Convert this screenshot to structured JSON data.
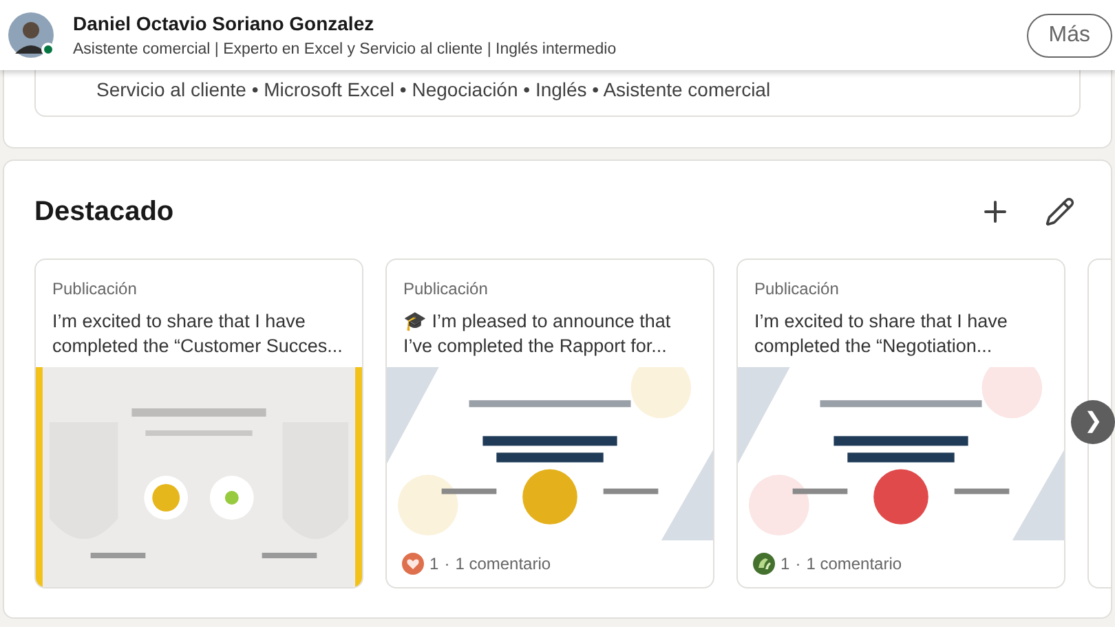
{
  "header": {
    "name": "Daniel Octavio Soriano Gonzalez",
    "headline": "Asistente comercial | Experto en Excel y Servicio al cliente | Inglés intermedio",
    "online": true,
    "more_button": "Más"
  },
  "skills": {
    "text": "Servicio al cliente • Microsoft Excel • Negociación • Inglés • Asistente comercial"
  },
  "featured": {
    "title": "Destacado",
    "items": [
      {
        "label": "Publicación",
        "lines": [
          "I’m excited to share that I have",
          "completed the “Customer Succes..."
        ]
      },
      {
        "label": "Publicación",
        "lines": [
          "🎓 I’m pleased to announce that",
          "I’ve completed the Rapport for..."
        ],
        "reaction": {
          "kind": "love"
        },
        "reactions": "1",
        "separator": "·",
        "comments": "1 comentario"
      },
      {
        "label": "Publicación",
        "lines": [
          "I’m excited to share that I have",
          "completed the “Negotiation..."
        ],
        "reaction": {
          "kind": "celebrate"
        },
        "reactions": "1",
        "separator": "·",
        "comments": "1 comentario"
      },
      {
        "kind": "cut_off"
      }
    ],
    "next_button": "❯"
  }
}
